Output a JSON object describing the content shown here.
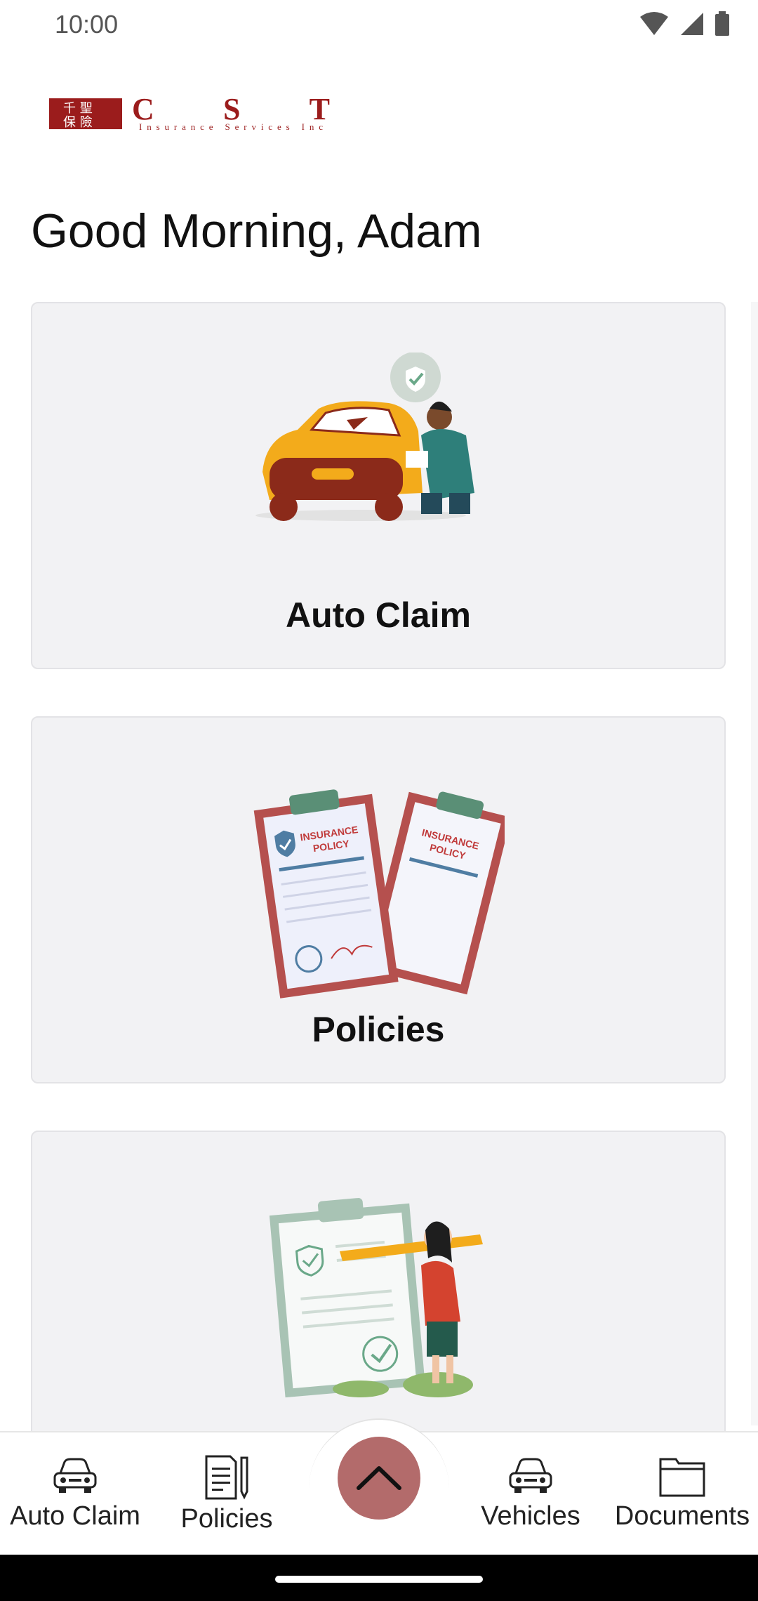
{
  "status_bar": {
    "time": "10:00"
  },
  "brand": {
    "logo_text": "CST",
    "logo_subtext": "Insurance Services Inc",
    "accent": "#9b1c1c"
  },
  "greeting": "Good Morning, Adam",
  "cards": [
    {
      "label": "Auto Claim",
      "illustration": "car-claim-illustration"
    },
    {
      "label": "Policies",
      "illustration": "insurance-policy-illustration",
      "illustration_text": "INSURANCE POLICY"
    },
    {
      "label": "",
      "illustration": "checklist-illustration"
    }
  ],
  "bottom_nav": {
    "items": [
      {
        "label": "Auto Claim",
        "icon": "car-icon"
      },
      {
        "label": "Policies",
        "icon": "document-pen-icon"
      },
      {
        "label": "Vehicles",
        "icon": "car-icon"
      },
      {
        "label": "Documents",
        "icon": "folder-icon"
      }
    ],
    "fab_icon": "chevron-up-icon",
    "fab_color": "#b36b6b"
  }
}
